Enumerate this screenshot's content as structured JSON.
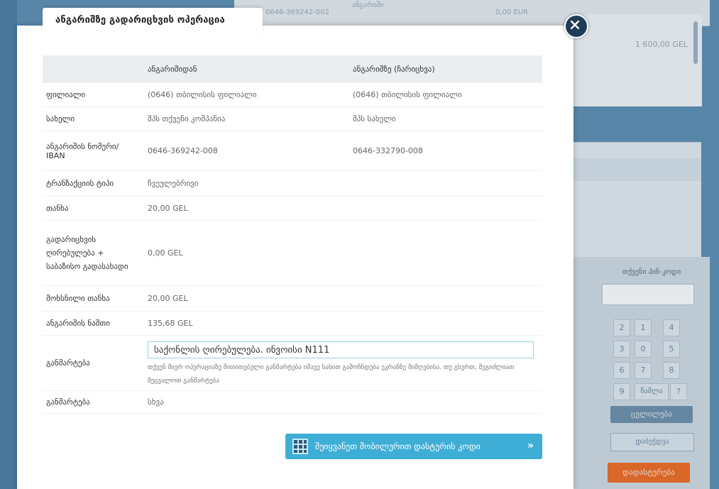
{
  "background": {
    "account_number": "0646-369242-002",
    "small_label": "ანგარიში",
    "amount_top": "0,00 EUR",
    "balance": "1 600,00 GEL"
  },
  "keypad": {
    "pin_label": "თქვენი პინ-კოდი",
    "keys": [
      "2",
      "1",
      "4",
      "3",
      "0",
      "5",
      "6",
      "7",
      "8",
      "9",
      "წაშლა",
      "?"
    ],
    "change_label": "ცვლილება",
    "print_label": "დაბეჭდვა",
    "confirm_label": "დადასტურება"
  },
  "modal": {
    "title": "ანგარიშზე გადარიცხვის ოპერაცია",
    "columns": {
      "from": "ანგარიშიდან",
      "to": "ანგარიშზე (ჩარიცხვა)"
    },
    "rows": [
      {
        "label": "ფილიალი",
        "from": "(0646) თბილისის ფილიალი",
        "to": "(0646) თბილისის ფილიალი"
      },
      {
        "label": "სახელი",
        "from": "შპს თქვენი კომპანია",
        "to": "შპს სახელი"
      },
      {
        "label": "ანგარიშის ნომერი/ IBAN",
        "from": "0646-369242-008",
        "to": "0646-332790-008"
      },
      {
        "label": "ტრანზაქციის ტიპი",
        "from": "ჩვეულებრივი",
        "to": ""
      },
      {
        "label": "თანხა",
        "from": "20,00 GEL",
        "to": ""
      },
      {
        "label": "გადარიცხვის ღირებულება + საბაზისო გადასახადი",
        "from": "0,00 GEL",
        "to": ""
      },
      {
        "label": "მოხსნილი თანხა",
        "from": "20,00 GEL",
        "to": ""
      },
      {
        "label": "ანგარიშის ნაშთი",
        "from": "135,68 GEL",
        "to": ""
      }
    ],
    "description": {
      "label": "განმარტება",
      "value": "საქონლის ღირებულება. ინვოისი N111",
      "note": "თქვენ მიერ ოპერაციაზე მითითებული განმარტება იმავე სახით გამოჩნდება ეკრანზე მიმღებისა. თუ გსურთ, შეგიძლიათ შეცვალოთ განმარტება"
    },
    "extra": {
      "label": "განმარტება",
      "value": "სხვა"
    },
    "mobile_button": "შეიყვანეთ მობილურით დასტურის კოდი",
    "mobile_arrow": "»"
  }
}
